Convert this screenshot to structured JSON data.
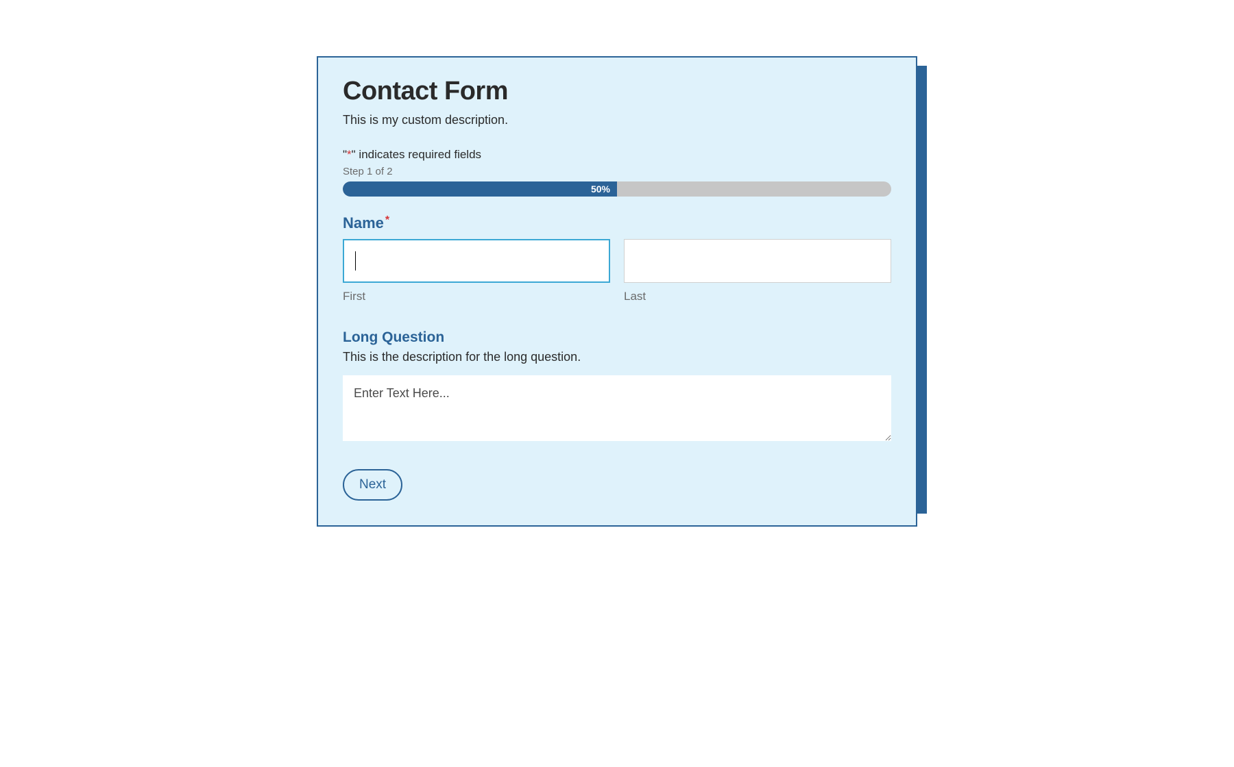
{
  "form": {
    "title": "Contact Form",
    "description": "This is my custom description.",
    "required_note_prefix": "\"",
    "required_note_asterisk": "*",
    "required_note_suffix": "\" indicates required fields",
    "step_label": "Step 1 of 2",
    "progress": {
      "percent": 50,
      "text": "50%"
    },
    "name_field": {
      "label": "Name",
      "required_marker": "*",
      "first": {
        "value": "",
        "sublabel": "First"
      },
      "last": {
        "value": "",
        "sublabel": "Last"
      }
    },
    "long_question": {
      "label": "Long Question",
      "description": "This is the description for the long question.",
      "placeholder": "Enter Text Here...",
      "value": ""
    },
    "next_button": "Next"
  }
}
